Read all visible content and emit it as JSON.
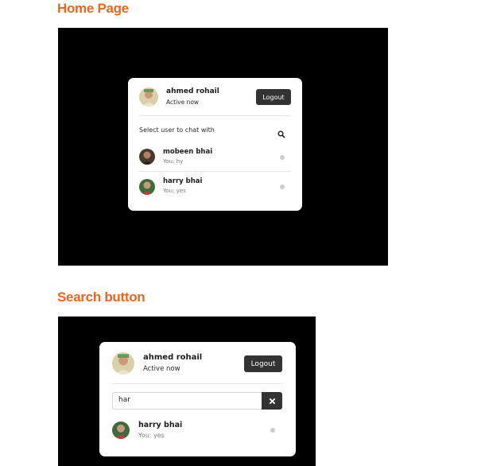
{
  "home": {
    "heading": "Home Page",
    "user": {
      "name": "ahmed rohail",
      "status": "Active now",
      "avatar_icon": "user-avatar-icon"
    },
    "logout_label": "Logout",
    "search_prompt": "Select user to chat with",
    "search_icon": "search-icon",
    "users": [
      {
        "name": "mobeen bhai",
        "message": "You: hy",
        "status_dot": "offline"
      },
      {
        "name": "harry bhai",
        "message": "You: yes",
        "status_dot": "offline"
      }
    ]
  },
  "search": {
    "heading": "Search button",
    "user": {
      "name": "ahmed rohail",
      "status": "Active now",
      "avatar_icon": "user-avatar-icon"
    },
    "logout_label": "Logout",
    "input_value": "har",
    "clear_icon": "close-icon",
    "results": [
      {
        "name": "harry bhai",
        "message": "You: yes",
        "status_dot": "offline"
      }
    ]
  },
  "colors": {
    "heading": "#e8671c",
    "stage_bg": "#000000",
    "button_bg": "#333333",
    "dot": "#cccccc"
  }
}
